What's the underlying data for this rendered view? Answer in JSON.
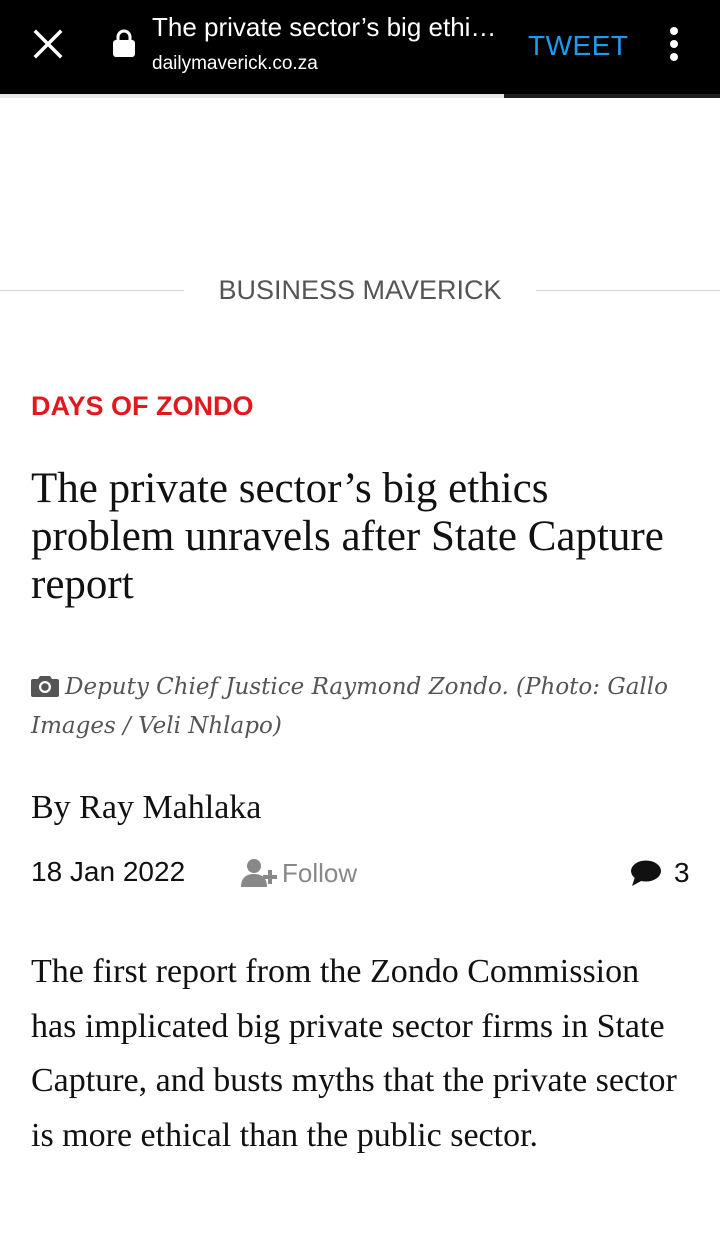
{
  "browser": {
    "title": "The private sector’s big ethi…",
    "domain": "dailymaverick.co.za",
    "tweet_label": "TWEET",
    "load_progress": 0.7
  },
  "section": {
    "label": "BUSINESS MAVERICK"
  },
  "article": {
    "kicker": "DAYS OF ZONDO",
    "headline": "The private sector’s big ethics problem unravels after State Capture report",
    "caption": "Deputy Chief Justice Raymond Zondo. (Photo: Gallo Images / Veli Nhlapo)",
    "byline": "By Ray Mahlaka",
    "date": "18 Jan 2022",
    "follow_label": "Follow",
    "comment_count": "3",
    "lede": "The first report from the Zondo Commission has implicated big private sector firms in State Capture, and busts myths that the private sector is more ethical than the public sector."
  },
  "colors": {
    "kicker_red": "#e1191f",
    "tweet_blue": "#1d9bf0",
    "topbar_bg": "#000000"
  },
  "icons": [
    "close-icon",
    "lock-icon",
    "more-vert-icon",
    "camera-icon",
    "user-plus-icon",
    "comment-icon"
  ]
}
